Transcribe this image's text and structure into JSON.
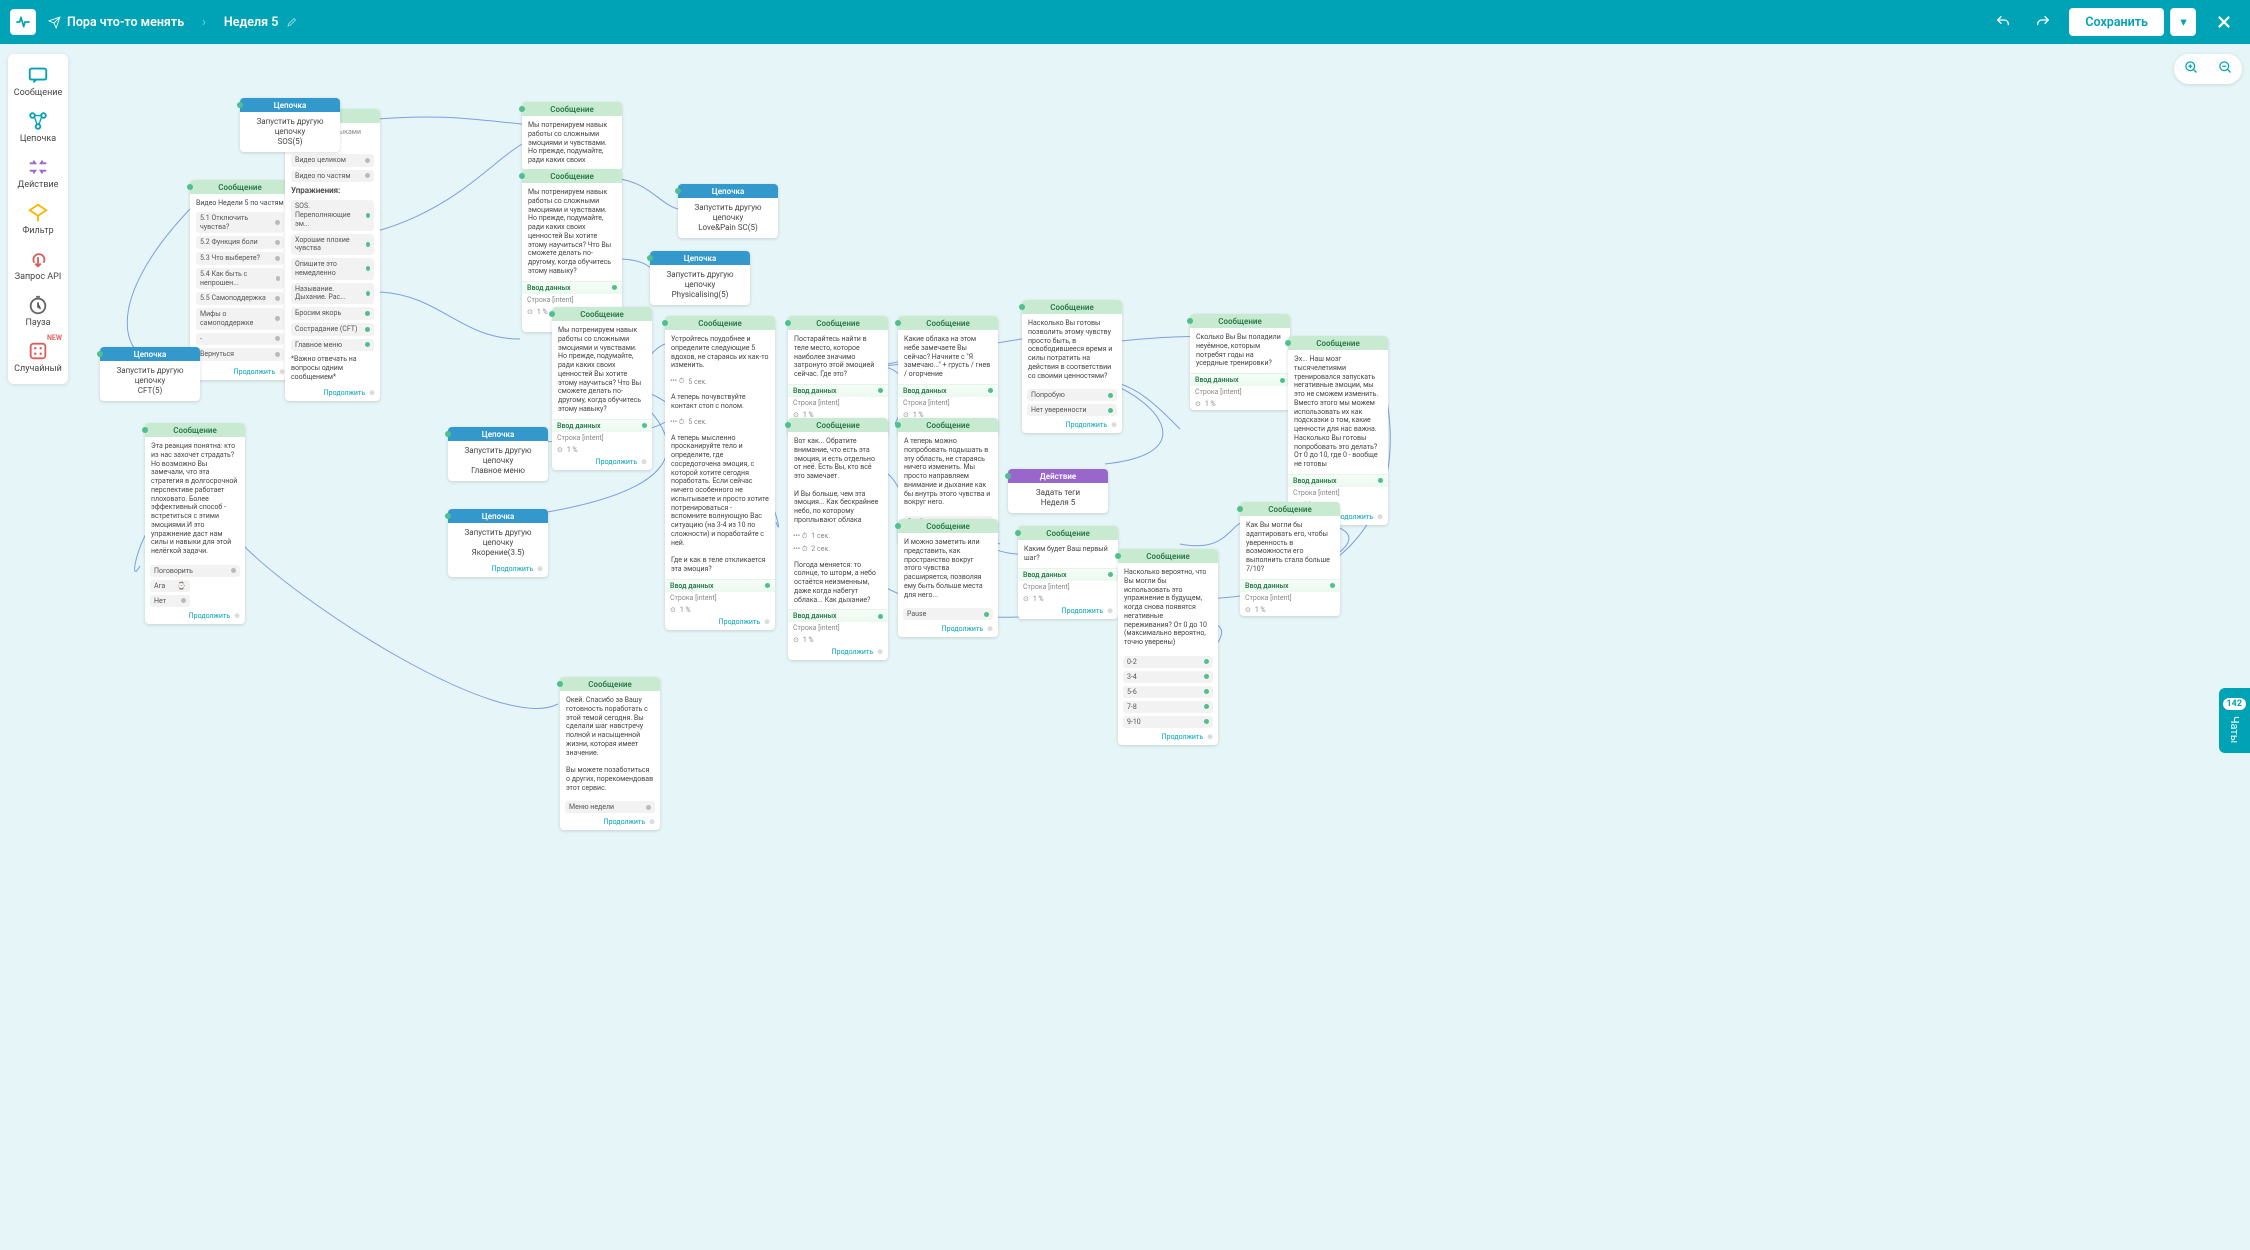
{
  "topbar": {
    "course_name": "Пора что-то менять",
    "breadcrumb": "Неделя 5",
    "save_label": "Сохранить"
  },
  "palette": [
    {
      "icon": "message",
      "label": "Сообщение"
    },
    {
      "icon": "chain",
      "label": "Цепочка"
    },
    {
      "icon": "action",
      "label": "Действие"
    },
    {
      "icon": "filter",
      "label": "Фильтр"
    },
    {
      "icon": "api",
      "label": "Запрос API"
    },
    {
      "icon": "pause",
      "label": "Пауза"
    },
    {
      "icon": "random",
      "label": "Случайный",
      "new": "NEW"
    }
  ],
  "chats": {
    "label": "Чаты",
    "count": "142"
  },
  "labels": {
    "msg": "Сообщение",
    "chain": "Цепочка",
    "action": "Действие",
    "run_other": "Запустить другую цепочку",
    "input": "Ввод данных",
    "string": "Строка   [intent]",
    "more": "Продолжить",
    "add": "+",
    "video": "Видео:",
    "video_whole": "Видео целиком",
    "video_parts": "Видео по частям",
    "exercises": "Упражнения:",
    "main_menu": "Главное меню",
    "week_menu": "Меню недели",
    "set_tags": "Задать теги",
    "week5": "Неделя 5",
    "one_pct": "1 %",
    "five_sec": "5 сек.",
    "one_sec": "1 сек.",
    "two_sec": "2 сек.",
    "try": "Попробую",
    "not_sure": "Нет уверенности",
    "ok": "Окей",
    "yep": "Ага",
    "no": "Нет",
    "talk": "Поговорить",
    "back": "Вернуться",
    "pause": "Раuse",
    "first_step": "Каким будет Ваш первый шаг?",
    "answer_one": "*Важно отвечать на вопросы одним сообщением*"
  },
  "nodes": {
    "n_sos": {
      "sub": "SOS(5)"
    },
    "n_cft": {
      "sub": "CFT(5)"
    },
    "n_lovepain": {
      "sub": "Love&Pain SC(5)"
    },
    "n_physical": {
      "sub": "Physicalising(5)"
    },
    "n_mainmenu": {
      "sub": "Главное меню"
    },
    "n_anchoring": {
      "sub": "Якорение(3.5)"
    },
    "n_videoweek": {
      "title": "Видео Недели 5 по частям",
      "items": [
        "5.1 Отключить чувства?",
        "5.2 Функция боли",
        "5.3 Что выберете?",
        "5.4 Как быть с непрошен...",
        "5.5 Самоподдержка",
        "Мифы о самоподдержке",
        "-"
      ]
    },
    "n_exerc": {
      "items": [
        "SOS. Переполняющие эм...",
        "Хорошие плохие чувства",
        "Опишите это немедленно",
        "Называние. Дыхание. Рас...",
        "Бросим якорь",
        "Сострадание (CFT)",
        "Главное меню"
      ]
    },
    "n_msg_long": {
      "text": "Эта реакция понятна: кто из нас захочет страдать? Но возможно Вы замечали, что эта стратегия в долгосрочной перспективе работает плоховато. Более эффективный способ - встретиться с этими эмоциями.И это упражнение даст нам силы и навыки для этой нелёгкой задачи."
    },
    "n_train1": {
      "text": "Мы потренируем навык работы со сложными эмоциями и чувствами. Но прежде, подумайте, ради каких своих"
    },
    "n_train2": {
      "text": "Мы потренируем навык работы со сложными эмоциями и чувствами. Но прежде, подумайте, ради каких своих ценностей Вы хотите этому научиться? Что Вы сможете делать по-другому, когда обучитесь этому навыку?"
    },
    "n_5q": {
      "text": "Устройтесь поудобнее и определите следующие 5 вдохов, не стараясь их как-то изменить."
    },
    "n_feel": {
      "text": "А теперь почувствуйте контакт стоп с полом."
    },
    "n_scan": {
      "text": "А теперь мысленно просканируйте тело и определите, где сосредоточена эмоция, с которой хотите сегодня поработать. Если сейчас ничего особенного не испытываете и просто хотите потренироваться - вспомните волнующую Вас ситуацию (на 3-4 из 10 по сложности) и поработайте с ней.\n\nГде и как в теле откликается эта эмоция?"
    },
    "n_attention": {
      "text": "Вот как... Обратите внимание, что есть эта эмоция, и есть отдельно от неё. Есть Вы, кто всё это замечает.\n\nИ Вы больше, чем эта эмоция... Как бескрайнее небо, по которому проплывают облака"
    },
    "n_notice": {
      "text": "А теперь можно попробовать подышать в эту область, не стараясь ничего изменить. Мы просто направляем внимание и дыхание как бы внутрь этого чувства и вокруг него."
    },
    "n_weather": {
      "text": "Погода меняется: то солнце, то шторм, а небо остаётся неизменным, даже когда набегут облака... Как дыхание?"
    },
    "n_bodyplace": {
      "text": "Постарайтесь найти в теле место, которое наиболее значимо затронуто этой эмоцией сейчас. Где это?"
    },
    "n_clouds": {
      "text": "Какие облака на этом небе замечаете Вы сейчас? Начните с \"Я замечаю...\" + грусть / гнев / огорчение"
    },
    "n_willing": {
      "text": "Насколько Вы готовы позволить этому чувству просто быть, в освободившееся время и силы потратить на действия в соответствии со своими ценностями?"
    },
    "n_spend": {
      "text": "Сколько Вы Вы поладили неуёмное, которым потребят годы на усердные тренировки?"
    },
    "n_ancient": {
      "text": "Эх... Наш мозг тысячелетиями тренировался запускать негативные эмоции, мы это не сможем изменить. Вместо этого мы можем использовать их как подсказки о том, какие ценности для нас важна. Насколько Вы готовы попробовать это делать? От 0 до 10, где 0 - вообще не готовы"
    },
    "n_adapt": {
      "text": "Как Вы могли бы адаптировать его, чтобы уверенность в возможности его выполнить стала больше 7/10?"
    },
    "n_space": {
      "text": "И можно заметить или представить, как пространство вокруг этого чувства расширяется, позволяя ему быть больше места для него..."
    },
    "n_likely": {
      "text": "Насколько вероятно, что Вы могли бы использовать это упражнение в будущем, когда снова появятся негативные переживания? От 0 до 10 (максимально вероятно, точно уверены)",
      "opts": [
        "0-2",
        "3-4",
        "5-6",
        "7-8",
        "9-10"
      ]
    },
    "n_thanks": {
      "text": "Окей. Спасибо за Вашу готовность поработать с этой темой сегодня. Вы сделали шаг навстречу полной и насыщенной жизни, которая имеет значение.\n\nВы можете позаботиться о других, порекомендовав этот сервис."
    }
  }
}
